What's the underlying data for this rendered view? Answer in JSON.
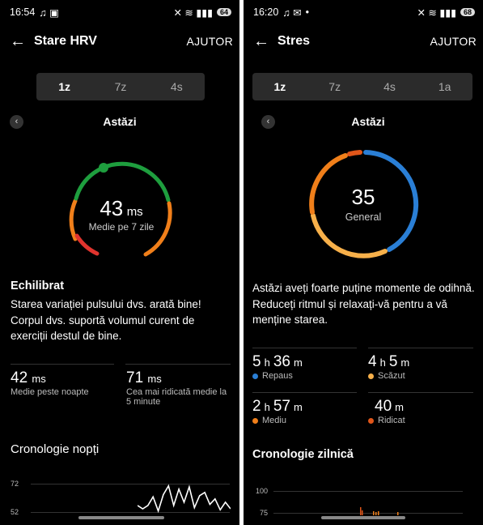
{
  "left": {
    "status": {
      "time": "16:54",
      "icons_left": "♫ ▣",
      "icons_right": "✕ ≋ ▮▮▮",
      "battery": "64"
    },
    "header": {
      "back": "←",
      "title": "Stare HRV",
      "help": "AJUTOR"
    },
    "tabs": [
      "1z",
      "7z",
      "4s"
    ],
    "selected_tab": "1z",
    "date": {
      "prev": "‹",
      "label": "Astăzi"
    },
    "gauge": {
      "value": "43",
      "unit": "ms",
      "sub": "Medie pe 7 zile",
      "colors": {
        "green": "#1e9e3e",
        "orange": "#f07f1a",
        "red": "#e0342e"
      }
    },
    "status_title": "Echilibrat",
    "status_text": "Starea variației pulsului dvs. arată bine! Corpul dvs. suportă volumul curent de exerciții destul de bine.",
    "stats": [
      {
        "value": "42",
        "unit": "ms",
        "label": "Medie peste noapte"
      },
      {
        "value": "71",
        "unit": "ms",
        "label": "Cea mai ridicată medie la 5 minute"
      }
    ],
    "chart_title": "Cronologie nopți",
    "chart_data": {
      "type": "line",
      "y_ticks": [
        "72",
        "52"
      ],
      "values": [
        52,
        49,
        52,
        60,
        47,
        62,
        70,
        52,
        67,
        55,
        69,
        50,
        61,
        64,
        53,
        58,
        48,
        55,
        49
      ]
    }
  },
  "right": {
    "status": {
      "time": "16:20",
      "icons_left": "♫ ✉",
      "dot": "•",
      "icons_right": "✕ ≋ ▮▮▮",
      "battery": "68"
    },
    "header": {
      "back": "←",
      "title": "Stres",
      "help": "AJUTOR"
    },
    "tabs": [
      "1z",
      "7z",
      "4s",
      "1a"
    ],
    "selected_tab": "1z",
    "date": {
      "prev": "‹",
      "label": "Astăzi"
    },
    "gauge": {
      "value": "35",
      "sub": "General",
      "colors": {
        "rest": "#2a7fd6",
        "low": "#f7b04a",
        "medium": "#f07f1a",
        "high": "#e0561a"
      }
    },
    "summary": "Astăzi aveți foarte puține momente de odihnă. Reduceți ritmul și relaxați-vă pentru a vă menține starea.",
    "stats": [
      {
        "h": "5",
        "hu": "h",
        "m": "36",
        "mu": "m",
        "label": "Repaus",
        "color": "#2a7fd6"
      },
      {
        "h": "4",
        "hu": "h",
        "m": "5",
        "mu": "m",
        "label": "Scăzut",
        "color": "#f7b04a"
      },
      {
        "h": "2",
        "hu": "h",
        "m": "57",
        "mu": "m",
        "label": "Mediu",
        "color": "#f07f1a"
      },
      {
        "h": "",
        "hu": "",
        "m": "40",
        "mu": "m",
        "label": "Ridicat",
        "color": "#e0561a"
      }
    ],
    "chart_title": "Cronologie zilnică",
    "chart_data": {
      "type": "bar",
      "y_ticks": [
        "100",
        "75"
      ]
    }
  }
}
